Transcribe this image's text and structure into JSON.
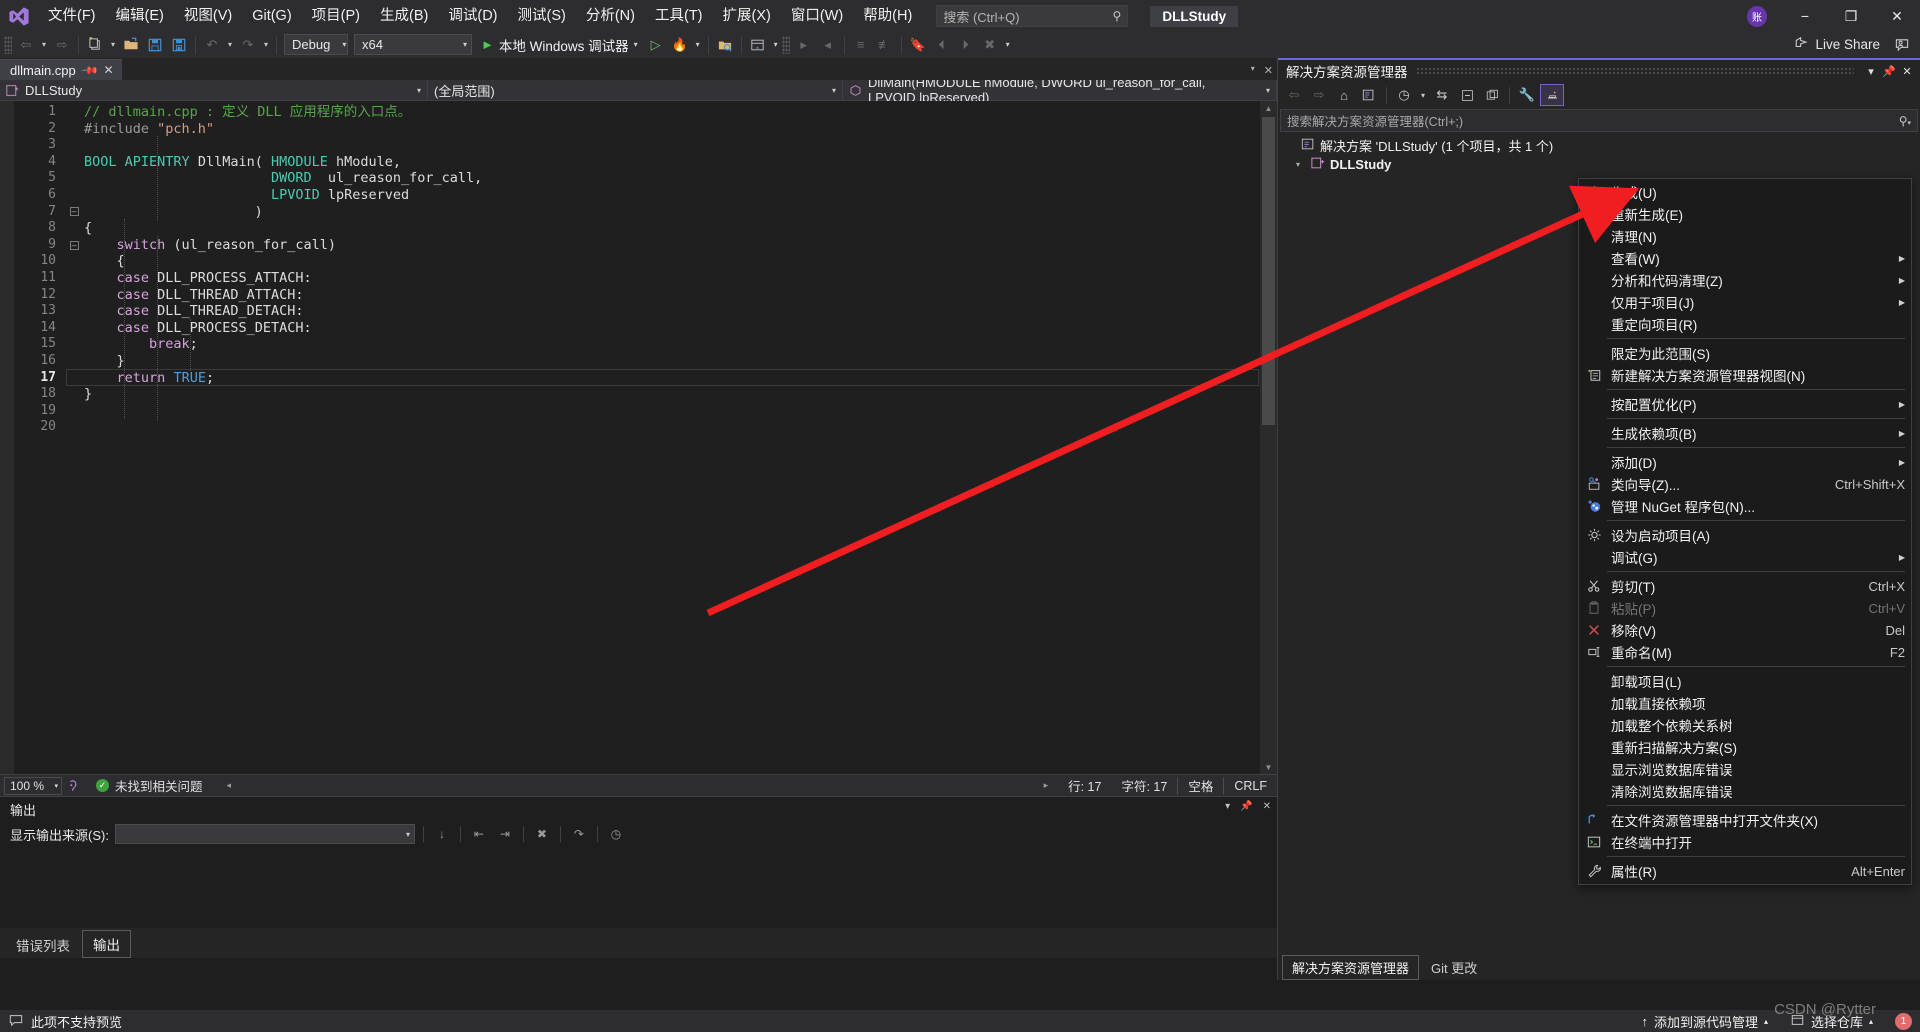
{
  "app": {
    "logo": "visual-studio-logo",
    "project_title": "DLLStudy"
  },
  "menubar": {
    "items": [
      {
        "label": "文件(F)"
      },
      {
        "label": "编辑(E)"
      },
      {
        "label": "视图(V)"
      },
      {
        "label": "Git(G)"
      },
      {
        "label": "项目(P)"
      },
      {
        "label": "生成(B)"
      },
      {
        "label": "调试(D)"
      },
      {
        "label": "测试(S)"
      },
      {
        "label": "分析(N)"
      },
      {
        "label": "工具(T)"
      },
      {
        "label": "扩展(X)"
      },
      {
        "label": "窗口(W)"
      },
      {
        "label": "帮助(H)"
      }
    ],
    "search_placeholder": "搜索 (Ctrl+Q)",
    "search_icon": "magnifier-icon"
  },
  "window_controls": {
    "minimize": "−",
    "maximize": "❐",
    "close": "✕",
    "account_initials": "账"
  },
  "toolbar": {
    "config": "Debug",
    "platform": "x64",
    "run_label": "本地 Windows 调试器",
    "live_share": "Live Share"
  },
  "editor": {
    "tab_name": "dllmain.cpp",
    "nav_scope_project": "DLLStudy",
    "nav_scope_global": "(全局范围)",
    "nav_member": "DllMain(HMODULE hModule, DWORD ul_reason_for_call, LPVOID lpReserved)",
    "current_line": 17,
    "lines": [
      {
        "n": 1,
        "tokens": [
          {
            "t": "// dllmain.cpp : 定义 DLL 应用程序的入口点。",
            "c": "k-comment"
          }
        ]
      },
      {
        "n": 2,
        "tokens": [
          {
            "t": "#include ",
            "c": "k-pp"
          },
          {
            "t": "\"pch.h\"",
            "c": "k-str"
          }
        ]
      },
      {
        "n": 3,
        "tokens": []
      },
      {
        "n": 4,
        "tokens": [
          {
            "t": "BOOL",
            "c": "k-type"
          },
          {
            "t": " ",
            "c": "k-punc"
          },
          {
            "t": "APIENTRY",
            "c": "k-type"
          },
          {
            "t": " ",
            "c": "k-punc"
          },
          {
            "t": "DllMain",
            "c": "k-id"
          },
          {
            "t": "( ",
            "c": "k-punc"
          },
          {
            "t": "HMODULE",
            "c": "k-type"
          },
          {
            "t": " hModule,",
            "c": "k-id"
          }
        ]
      },
      {
        "n": 5,
        "tokens": [
          {
            "t": "                       ",
            "c": "k-punc"
          },
          {
            "t": "DWORD",
            "c": "k-type"
          },
          {
            "t": "  ul_reason_for_call,",
            "c": "k-id"
          }
        ]
      },
      {
        "n": 6,
        "tokens": [
          {
            "t": "                       ",
            "c": "k-punc"
          },
          {
            "t": "LPVOID",
            "c": "k-type"
          },
          {
            "t": " lpReserved",
            "c": "k-id"
          }
        ]
      },
      {
        "n": 7,
        "tokens": [
          {
            "t": "                     )",
            "c": "k-punc"
          }
        ],
        "fold": true
      },
      {
        "n": 8,
        "tokens": [
          {
            "t": "{",
            "c": "k-punc"
          }
        ]
      },
      {
        "n": 9,
        "tokens": [
          {
            "t": "    ",
            "c": "k-punc"
          },
          {
            "t": "switch",
            "c": "k-ctl"
          },
          {
            "t": " (ul_reason_for_call)",
            "c": "k-id"
          }
        ],
        "fold": true
      },
      {
        "n": 10,
        "tokens": [
          {
            "t": "    {",
            "c": "k-punc"
          }
        ]
      },
      {
        "n": 11,
        "tokens": [
          {
            "t": "    ",
            "c": "k-punc"
          },
          {
            "t": "case",
            "c": "k-ctl"
          },
          {
            "t": " ",
            "c": "k-punc"
          },
          {
            "t": "DLL_PROCESS_ATTACH",
            "c": "k-id"
          },
          {
            "t": ":",
            "c": "k-punc"
          }
        ]
      },
      {
        "n": 12,
        "tokens": [
          {
            "t": "    ",
            "c": "k-punc"
          },
          {
            "t": "case",
            "c": "k-ctl"
          },
          {
            "t": " ",
            "c": "k-punc"
          },
          {
            "t": "DLL_THREAD_ATTACH",
            "c": "k-id"
          },
          {
            "t": ":",
            "c": "k-punc"
          }
        ]
      },
      {
        "n": 13,
        "tokens": [
          {
            "t": "    ",
            "c": "k-punc"
          },
          {
            "t": "case",
            "c": "k-ctl"
          },
          {
            "t": " ",
            "c": "k-punc"
          },
          {
            "t": "DLL_THREAD_DETACH",
            "c": "k-id"
          },
          {
            "t": ":",
            "c": "k-punc"
          }
        ]
      },
      {
        "n": 14,
        "tokens": [
          {
            "t": "    ",
            "c": "k-punc"
          },
          {
            "t": "case",
            "c": "k-ctl"
          },
          {
            "t": " ",
            "c": "k-punc"
          },
          {
            "t": "DLL_PROCESS_DETACH",
            "c": "k-id"
          },
          {
            "t": ":",
            "c": "k-punc"
          }
        ]
      },
      {
        "n": 15,
        "tokens": [
          {
            "t": "        ",
            "c": "k-punc"
          },
          {
            "t": "break",
            "c": "k-ctl"
          },
          {
            "t": ";",
            "c": "k-punc"
          }
        ]
      },
      {
        "n": 16,
        "tokens": [
          {
            "t": "    }",
            "c": "k-punc"
          }
        ]
      },
      {
        "n": 17,
        "tokens": [
          {
            "t": "    ",
            "c": "k-punc"
          },
          {
            "t": "return",
            "c": "k-ctl"
          },
          {
            "t": " ",
            "c": "k-punc"
          },
          {
            "t": "TRUE",
            "c": "k-kw"
          },
          {
            "t": ";",
            "c": "k-punc"
          }
        ]
      },
      {
        "n": 18,
        "tokens": [
          {
            "t": "}",
            "c": "k-punc"
          }
        ]
      },
      {
        "n": 19,
        "tokens": []
      },
      {
        "n": 20,
        "tokens": []
      }
    ],
    "status": {
      "zoom": "100 %",
      "issues": "未找到相关问题",
      "line_label": "行: 17",
      "char_label": "字符: 17",
      "spaces": "空格",
      "eol": "CRLF"
    }
  },
  "output_pane": {
    "title": "输出",
    "source_label": "显示输出来源(S):",
    "source_value": ""
  },
  "bottom_tabs": {
    "items": [
      {
        "label": "错误列表",
        "active": false
      },
      {
        "label": "输出",
        "active": true
      }
    ]
  },
  "solution_explorer": {
    "title": "解决方案资源管理器",
    "search_placeholder": "搜索解决方案资源管理器(Ctrl+;)",
    "solution_node": "解决方案 'DLLStudy' (1 个项目，共 1 个)",
    "project_node": "DLLStudy",
    "tabs": [
      {
        "label": "解决方案资源管理器",
        "active": true
      },
      {
        "label": "Git 更改",
        "active": false
      }
    ],
    "toolbar_icons": [
      "back-icon",
      "forward-icon",
      "home-icon",
      "solution-view-icon",
      "pending-changes-icon",
      "sync-with-active-document-icon",
      "collapse-all-icon",
      "show-all-files-icon",
      "properties-icon",
      "preview-selected-items-icon"
    ]
  },
  "context_menu": {
    "items": [
      {
        "label": "生成(U)",
        "icon": "build-icon",
        "key": "",
        "submenu": false,
        "disabled": false,
        "sep_after": false
      },
      {
        "label": "重新生成(E)",
        "icon": "",
        "key": "",
        "submenu": false,
        "disabled": false,
        "sep_after": false
      },
      {
        "label": "清理(N)",
        "icon": "",
        "key": "",
        "submenu": false,
        "disabled": false,
        "sep_after": false
      },
      {
        "label": "查看(W)",
        "icon": "",
        "key": "",
        "submenu": true,
        "disabled": false,
        "sep_after": false
      },
      {
        "label": "分析和代码清理(Z)",
        "icon": "",
        "key": "",
        "submenu": true,
        "disabled": false,
        "sep_after": false
      },
      {
        "label": "仅用于项目(J)",
        "icon": "",
        "key": "",
        "submenu": true,
        "disabled": false,
        "sep_after": false
      },
      {
        "label": "重定向项目(R)",
        "icon": "",
        "key": "",
        "submenu": false,
        "disabled": false,
        "sep_after": true
      },
      {
        "label": "限定为此范围(S)",
        "icon": "",
        "key": "",
        "submenu": false,
        "disabled": false,
        "sep_after": false
      },
      {
        "label": "新建解决方案资源管理器视图(N)",
        "icon": "new-se-view-icon",
        "key": "",
        "submenu": false,
        "disabled": false,
        "sep_after": true
      },
      {
        "label": "按配置优化(P)",
        "icon": "",
        "key": "",
        "submenu": true,
        "disabled": false,
        "sep_after": true
      },
      {
        "label": "生成依赖项(B)",
        "icon": "",
        "key": "",
        "submenu": true,
        "disabled": false,
        "sep_after": true
      },
      {
        "label": "添加(D)",
        "icon": "",
        "key": "",
        "submenu": true,
        "disabled": false,
        "sep_after": false
      },
      {
        "label": "类向导(Z)...",
        "icon": "class-wizard-icon",
        "key": "Ctrl+Shift+X",
        "submenu": false,
        "disabled": false,
        "sep_after": false
      },
      {
        "label": "管理 NuGet 程序包(N)...",
        "icon": "nuget-icon",
        "key": "",
        "submenu": false,
        "disabled": false,
        "sep_after": true
      },
      {
        "label": "设为启动项目(A)",
        "icon": "gear-icon",
        "key": "",
        "submenu": false,
        "disabled": false,
        "sep_after": false
      },
      {
        "label": "调试(G)",
        "icon": "",
        "key": "",
        "submenu": true,
        "disabled": false,
        "sep_after": true
      },
      {
        "label": "剪切(T)",
        "icon": "scissors-icon",
        "key": "Ctrl+X",
        "submenu": false,
        "disabled": false,
        "sep_after": false
      },
      {
        "label": "粘贴(P)",
        "icon": "clipboard-icon",
        "key": "Ctrl+V",
        "submenu": false,
        "disabled": true,
        "sep_after": false
      },
      {
        "label": "移除(V)",
        "icon": "remove-x-icon",
        "key": "Del",
        "submenu": false,
        "disabled": false,
        "sep_after": false
      },
      {
        "label": "重命名(M)",
        "icon": "rename-icon",
        "key": "F2",
        "submenu": false,
        "disabled": false,
        "sep_after": true
      },
      {
        "label": "卸载项目(L)",
        "icon": "",
        "key": "",
        "submenu": false,
        "disabled": false,
        "sep_after": false
      },
      {
        "label": "加载直接依赖项",
        "icon": "",
        "key": "",
        "submenu": false,
        "disabled": false,
        "sep_after": false
      },
      {
        "label": "加载整个依赖关系树",
        "icon": "",
        "key": "",
        "submenu": false,
        "disabled": false,
        "sep_after": false
      },
      {
        "label": "重新扫描解决方案(S)",
        "icon": "",
        "key": "",
        "submenu": false,
        "disabled": false,
        "sep_after": false
      },
      {
        "label": "显示浏览数据库错误",
        "icon": "",
        "key": "",
        "submenu": false,
        "disabled": false,
        "sep_after": false
      },
      {
        "label": "清除浏览数据库错误",
        "icon": "",
        "key": "",
        "submenu": false,
        "disabled": false,
        "sep_after": true
      },
      {
        "label": "在文件资源管理器中打开文件夹(X)",
        "icon": "open-folder-icon",
        "key": "",
        "submenu": false,
        "disabled": false,
        "sep_after": false
      },
      {
        "label": "在终端中打开",
        "icon": "terminal-icon",
        "key": "",
        "submenu": false,
        "disabled": false,
        "sep_after": true
      },
      {
        "label": "属性(R)",
        "icon": "wrench-icon",
        "key": "Alt+Enter",
        "submenu": false,
        "disabled": false,
        "sep_after": false
      }
    ]
  },
  "statusbar": {
    "preview_text": "此项不支持预览",
    "add_to_source_control": "添加到源代码管理",
    "select_repo": "选择仓库",
    "notification_count": "1"
  },
  "watermark": "CSDN @Rytter",
  "colors": {
    "accent": "#6a6ad6",
    "annotation_arrow": "#f01e20",
    "run_green": "#4ec94e",
    "chrome": "#2d2d30",
    "editor_bg": "#1f1f1f"
  }
}
